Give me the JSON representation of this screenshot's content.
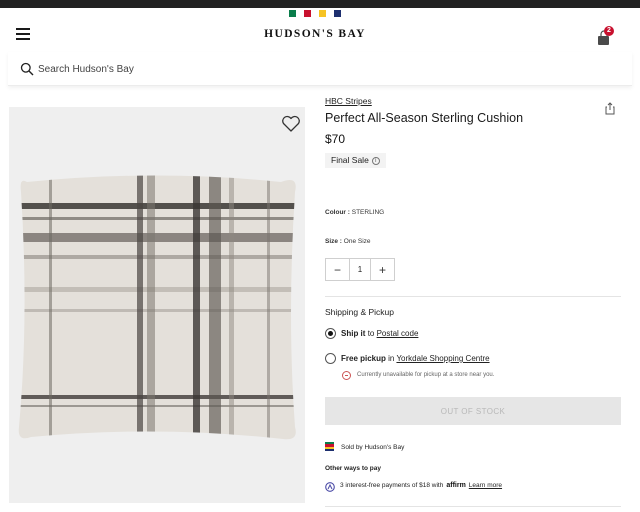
{
  "header": {
    "logo_text": "HUDSON'S BAY",
    "stripe_colors": [
      "#0a7d4b",
      "#c8102e",
      "#f6c324",
      "#1d2f6f"
    ],
    "cart_count": "2"
  },
  "search": {
    "placeholder": "Search Hudson's Bay"
  },
  "product": {
    "brand": "HBC Stripes",
    "title": "Perfect All-Season Sterling Cushion",
    "price": "$70",
    "final_sale": "Final Sale",
    "colour_label": "Colour :",
    "colour_value": "STERLING",
    "size_label": "Size :",
    "size_value": "One Size",
    "quantity": "1"
  },
  "shipping": {
    "title": "Shipping & Pickup",
    "ship_bold": "Ship it",
    "ship_to": "to",
    "ship_link": "Postal code",
    "pickup_bold": "Free pickup",
    "pickup_in": "in",
    "pickup_link": "Yorkdale Shopping Centre",
    "unavailable": "Currently unavailable for pickup at a store near you."
  },
  "cta": {
    "out_of_stock": "OUT OF STOCK"
  },
  "seller": {
    "sold_by": "Sold by Hudson's Bay"
  },
  "payments": {
    "title": "Other ways to pay",
    "affirm_text": "3 interest-free payments of $18 with",
    "affirm_logo": "affirm",
    "learn_more": "Learn more"
  },
  "icons": {
    "menu": "menu-icon",
    "bag": "shopping-bag-icon",
    "search": "search-icon",
    "favorite": "heart-icon",
    "share": "share-icon",
    "info": "info-icon",
    "unavailable": "minus-circle-icon",
    "sold": "hbc-stripes-icon",
    "affirm": "affirm-icon"
  },
  "colors": {
    "accent_red": "#c8102e",
    "image_bg": "#efefef",
    "oos_bg": "#e6e6e6"
  }
}
